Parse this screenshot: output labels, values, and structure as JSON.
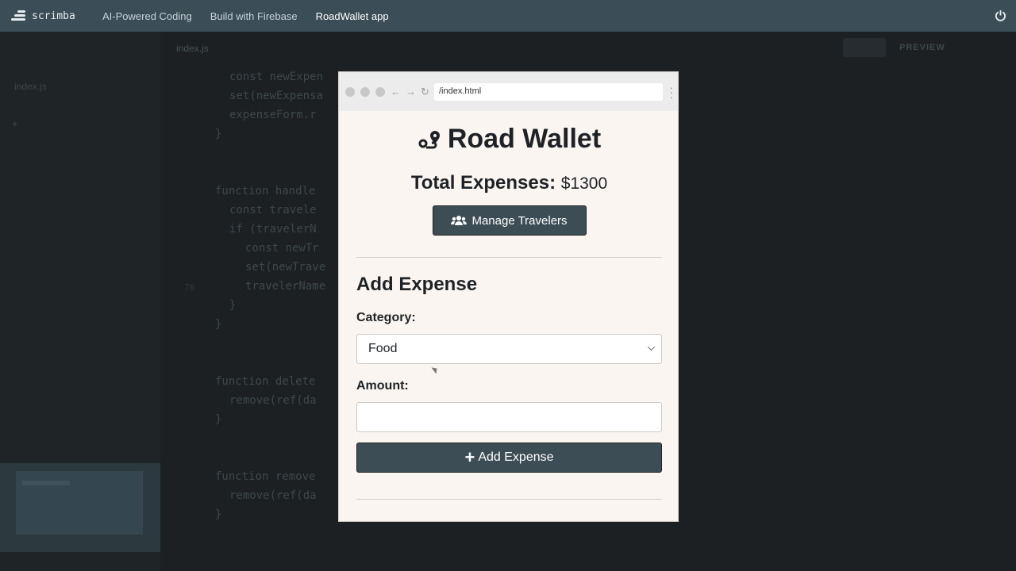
{
  "topbar": {
    "logo": "scrimba",
    "crumbs": [
      "AI-Powered Coding",
      "Build with Firebase",
      "RoadWallet app"
    ]
  },
  "editor": {
    "tab": "index.js",
    "file": "index.js",
    "preview_label": "PREVIEW",
    "code": [
      "const newExpen",
      "set(newExpensa",
      "expenseForm.r",
      "}",
      "function handle",
      "const travele",
      "if (travelerN",
      "const newTr",
      "set(newTrave",
      "travelerName",
      "}",
      "}",
      "function delete",
      "remove(ref(da",
      "}",
      "function remove",
      "remove(ref(da",
      "}"
    ],
    "line_numbers": [
      "76"
    ]
  },
  "browser": {
    "url": "/index.html"
  },
  "app": {
    "title": "Road Wallet",
    "total_label": "Total Expenses:",
    "total_value": "$1300",
    "manage_button": "Manage Travelers",
    "section_title": "Add Expense",
    "category_label": "Category:",
    "category_value": "Food",
    "amount_label": "Amount:",
    "amount_value": "",
    "add_button": "Add Expense"
  },
  "colors": {
    "topbar": "#3b4d57",
    "button": "#3d4d55",
    "app_bg": "#fbf5f1"
  }
}
